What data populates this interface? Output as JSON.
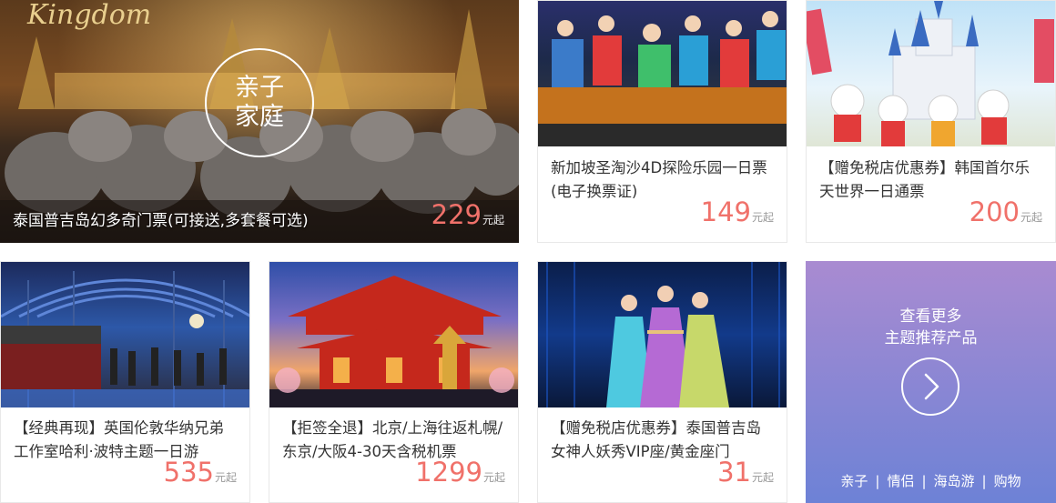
{
  "products": [
    {
      "title": "泰国普吉岛幻多奇门票(可接送,多套餐可选)",
      "price": "229",
      "unit": "元起",
      "badge_line1": "亲子",
      "badge_line2": "家庭",
      "logo": "Kingdom",
      "image": "elephant-show-photo"
    },
    {
      "title": "新加坡圣淘沙4D探险乐园一日票(电子换票证)",
      "price": "149",
      "unit": "元起",
      "image": "4d-ride-photo"
    },
    {
      "title": "【赠免税店优惠券】韩国首尔乐天世界一日通票",
      "price": "200",
      "unit": "元起",
      "image": "lotte-world-castle-photo"
    },
    {
      "title": "【经典再现】英国伦敦华纳兄弟工作室哈利·波特主题一日游",
      "price": "535",
      "unit": "元起",
      "image": "harry-potter-station-photo"
    },
    {
      "title": "【拒签全退】北京/上海往返札幌/东京/大阪4-30天含税机票",
      "price": "1299",
      "unit": "元起",
      "image": "japan-temple-photo"
    },
    {
      "title": "【赠免税店优惠券】泰国普吉岛女神人妖秀VIP座/黄金座门",
      "price": "31",
      "unit": "元起",
      "image": "show-performers-photo"
    }
  ],
  "more": {
    "line1": "查看更多",
    "line2": "主题推荐产品",
    "tags": [
      "亲子",
      "情侣",
      "海岛游",
      "购物"
    ]
  }
}
